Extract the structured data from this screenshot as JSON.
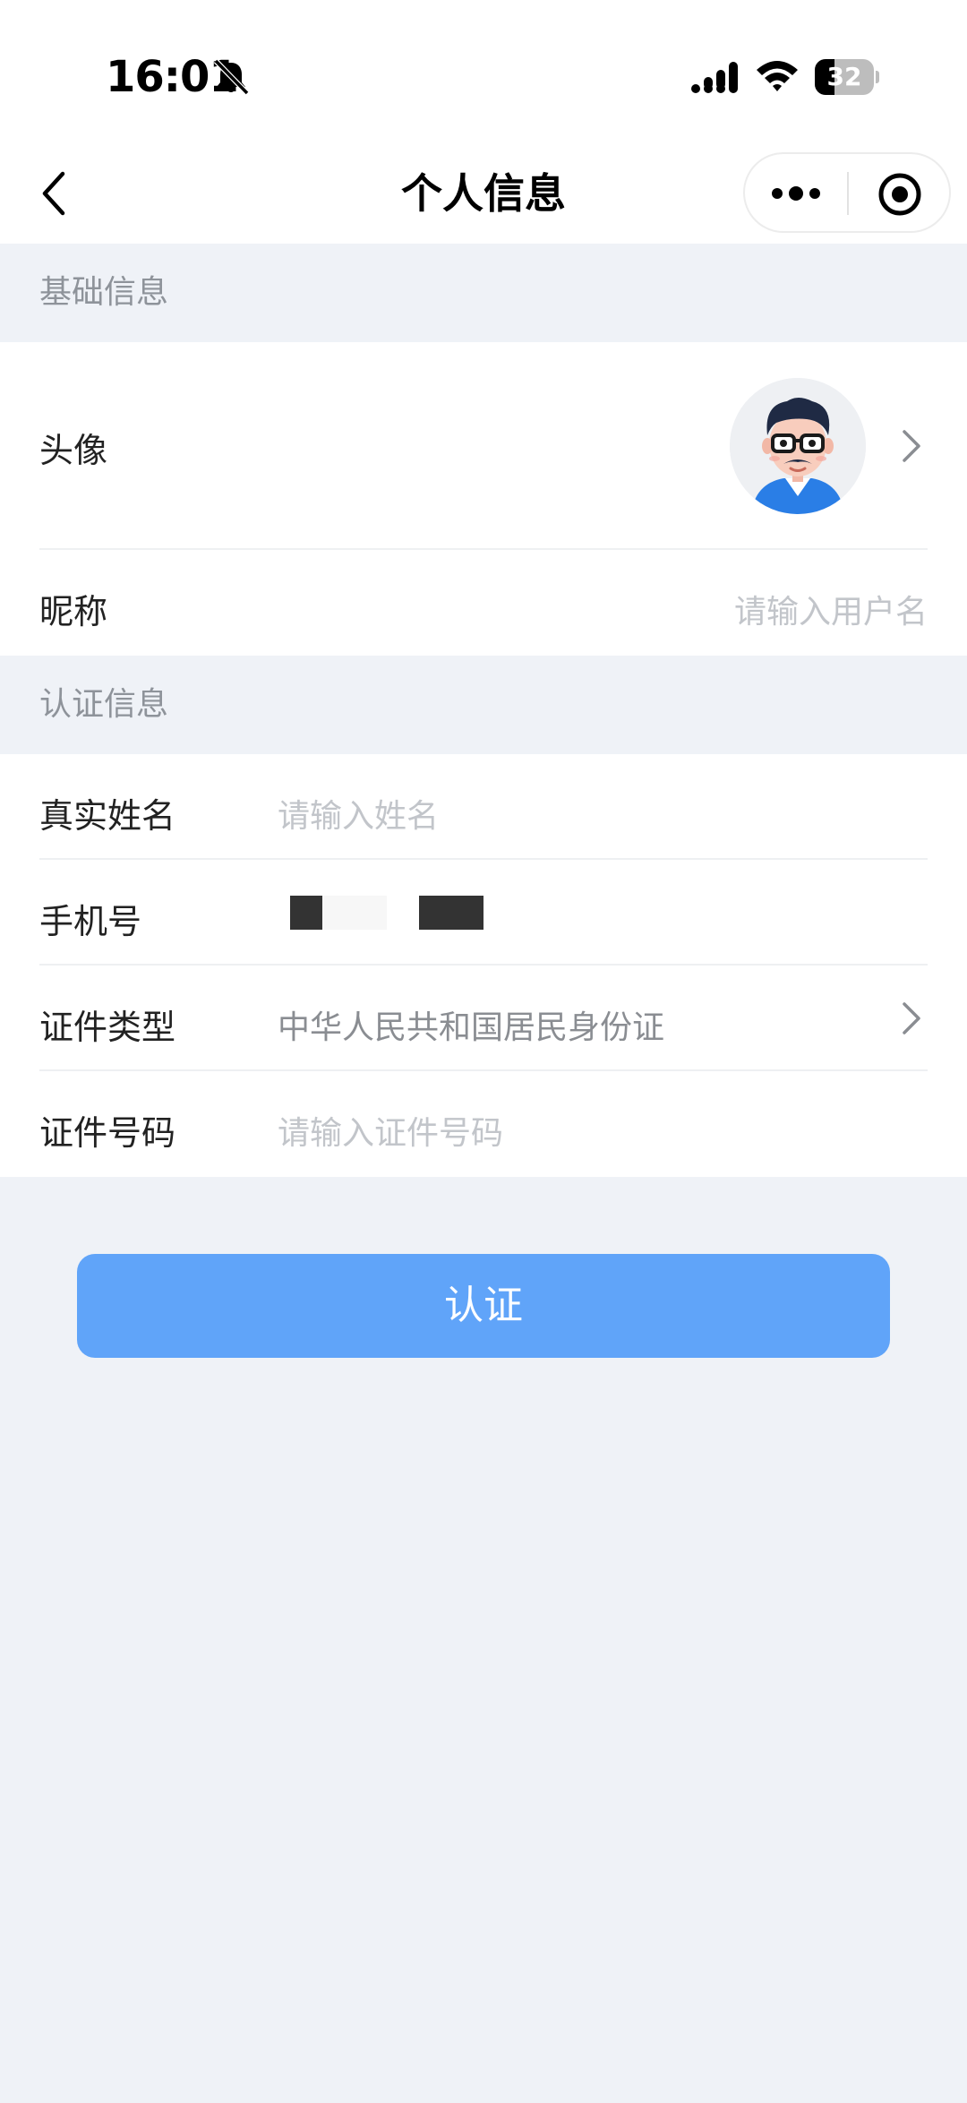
{
  "status_bar": {
    "time": "16:01",
    "battery_level": "32",
    "icons": [
      "bell-slash-icon",
      "cellular-signal-icon",
      "wifi-icon",
      "battery-icon"
    ]
  },
  "nav": {
    "title": "个人信息",
    "icons": [
      "back-chevron-icon",
      "more-dots-icon",
      "target-circle-icon"
    ]
  },
  "basic_section": {
    "header": "基础信息",
    "avatar_label": "头像",
    "nickname_label": "昵称",
    "nickname_placeholder": "请输入用户名"
  },
  "auth_section": {
    "header": "认证信息",
    "real_name_label": "真实姓名",
    "real_name_placeholder": "请输入姓名",
    "phone_label": "手机号",
    "id_type_label": "证件类型",
    "id_type_value": "中华人民共和国居民身份证",
    "id_number_label": "证件号码",
    "id_number_placeholder": "请输入证件号码"
  },
  "verify_button": "认证",
  "colors": {
    "page_bg": "#eff2f7",
    "card_bg": "#ffffff",
    "primary_button": "#60a4f9",
    "section_header_text": "#8e939a",
    "placeholder_text": "#c2c5ca"
  }
}
